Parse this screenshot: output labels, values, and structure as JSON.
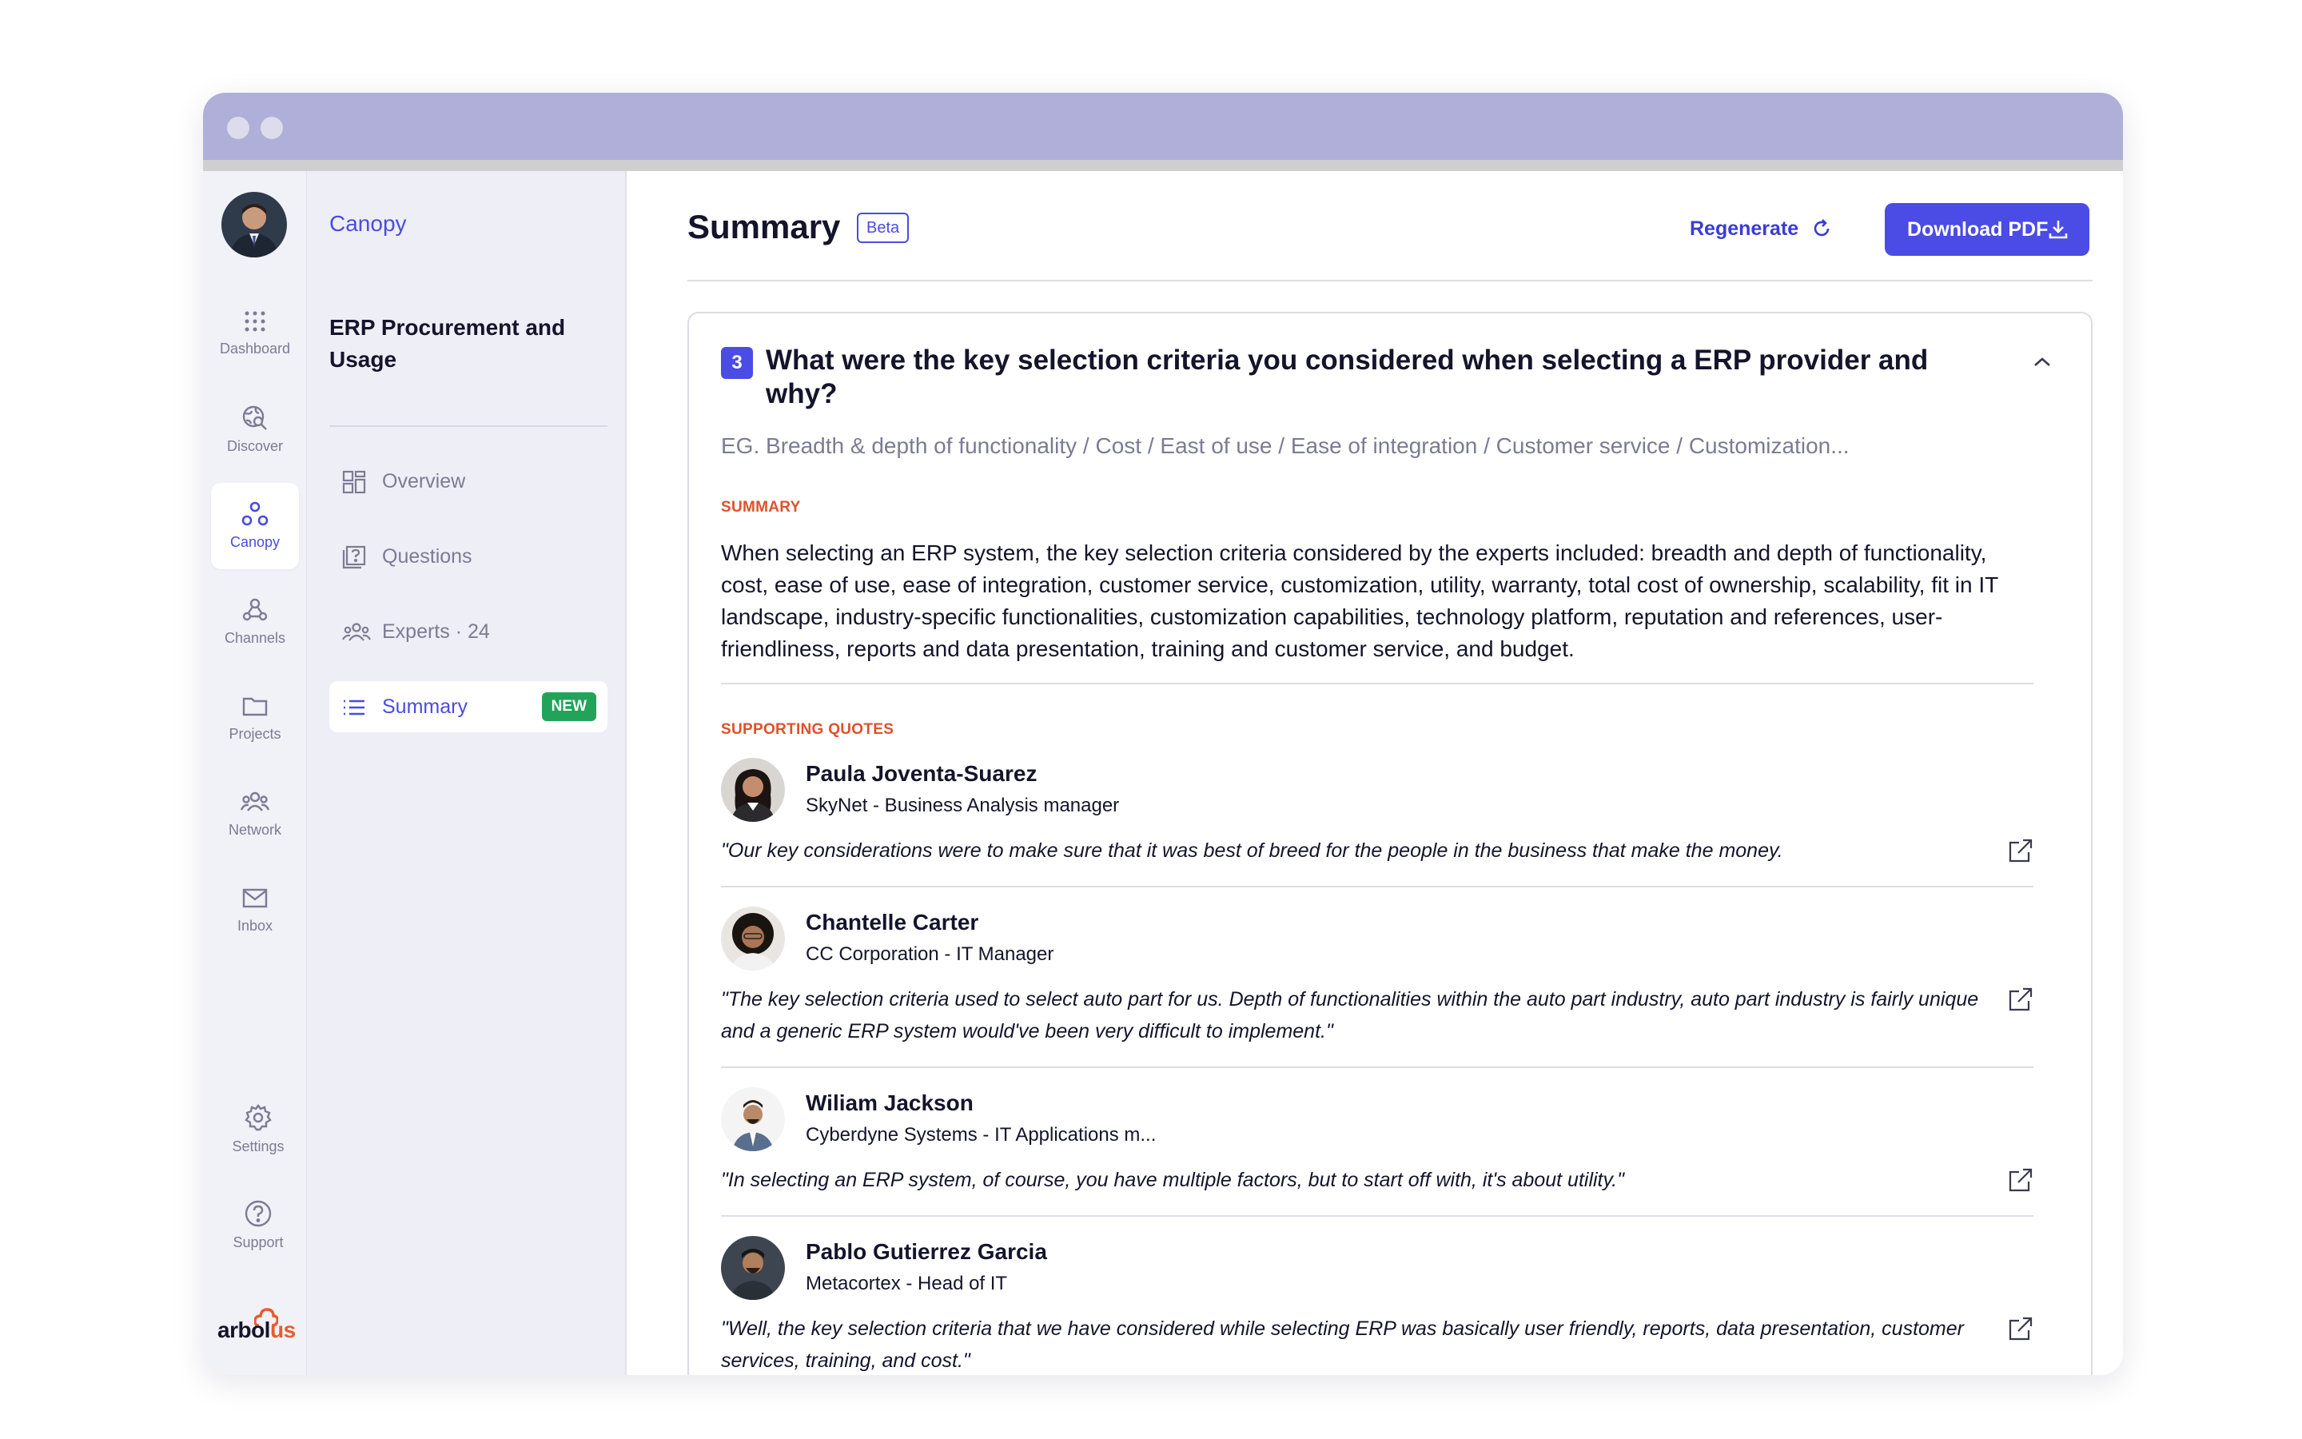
{
  "app": {
    "brand_prefix": "arbol",
    "brand_suffix": "us"
  },
  "rail": {
    "items": [
      {
        "label": "Dashboard",
        "icon": "grid-dots-icon"
      },
      {
        "label": "Discover",
        "icon": "globe-search-icon"
      },
      {
        "label": "Canopy",
        "icon": "canopy-circles-icon"
      },
      {
        "label": "Channels",
        "icon": "webhook-icon"
      },
      {
        "label": "Projects",
        "icon": "folder-icon"
      },
      {
        "label": "Network",
        "icon": "people-icon"
      },
      {
        "label": "Inbox",
        "icon": "mail-icon"
      }
    ],
    "bottom": [
      {
        "label": "Settings",
        "icon": "gear-icon"
      },
      {
        "label": "Support",
        "icon": "help-circle-icon"
      }
    ]
  },
  "panel": {
    "breadcrumb": "Canopy",
    "title": "ERP Procurement and Usage",
    "nav": [
      {
        "label": "Overview"
      },
      {
        "label": "Questions"
      },
      {
        "label": "Experts · 24"
      },
      {
        "label": "Summary",
        "badge": "NEW"
      }
    ]
  },
  "header": {
    "title": "Summary",
    "beta": "Beta",
    "regenerate": "Regenerate",
    "download": "Download PDF"
  },
  "question": {
    "number": "3",
    "text": "What were the key selection criteria you considered when selecting a ERP provider and why?",
    "hint": "EG. Breadth & depth of functionality / Cost / East of use / Ease of integration / Customer service / Customization...",
    "summary_label": "SUMMARY",
    "summary": "When selecting an ERP system, the key selection criteria considered by the experts included: breadth and depth of functionality, cost, ease of use, ease of integration, customer service, customization, utility, warranty, total cost of ownership, scalability, fit in IT landscape, industry-specific functionalities, customization capabilities, technology platform, reputation and references, user-friendliness, reports and data presentation, training and customer service, and budget.",
    "quotes_label": "SUPPORTING QUOTES",
    "quotes": [
      {
        "name": "Paula Joventa-Suarez",
        "role": "SkyNet - Business Analysis manager",
        "quote": "\"Our key considerations were to make sure that it was best of breed for the people in the business that make the money."
      },
      {
        "name": "Chantelle Carter",
        "role": "CC Corporation - IT Manager",
        "quote": "\"The key selection criteria used to select auto part for us. Depth of functionalities within the auto part industry, auto part industry is fairly unique and a generic ERP system would've been very difficult to implement.\""
      },
      {
        "name": "Wiliam Jackson",
        "role": "Cyberdyne Systems - IT Applications m...",
        "quote": "\"In selecting an ERP system, of course, you have multiple factors, but to start off with, it's about utility.\""
      },
      {
        "name": "Pablo Gutierrez Garcia",
        "role": "Metacortex - Head of IT",
        "quote": "\"Well, the key selection criteria that we have considered while selecting ERP was basically user friendly, reports, data presentation, customer services, training, and cost.\""
      }
    ]
  },
  "colors": {
    "accent": "#4b4be6",
    "titlebar": "#afafd9",
    "badge_green": "#23a35a",
    "label_orange": "#e0502a"
  }
}
